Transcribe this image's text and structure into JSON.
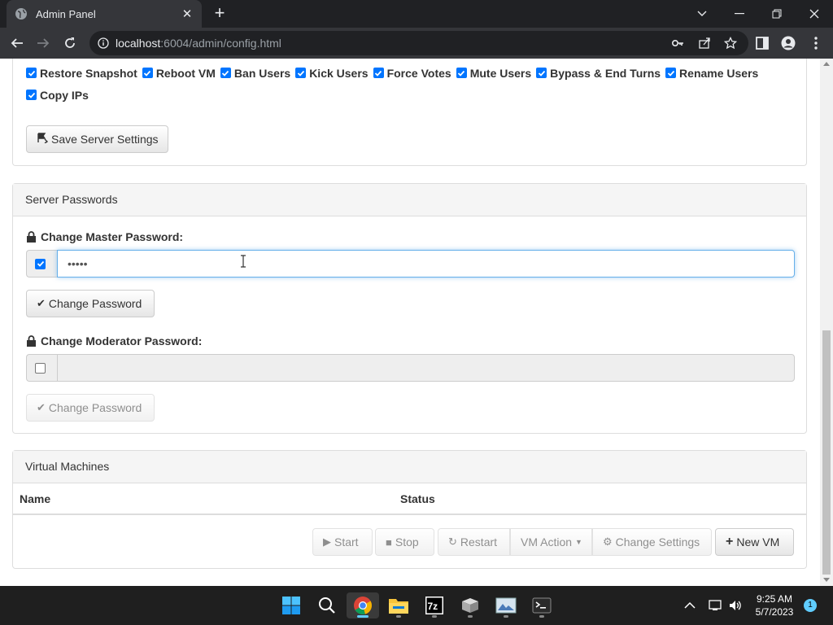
{
  "browser": {
    "tab_title": "Admin Panel",
    "url_host": "localhost",
    "url_rest": ":6004/admin/config.html"
  },
  "permissions": [
    {
      "label": "Restore Snapshot",
      "checked": true
    },
    {
      "label": "Reboot VM",
      "checked": true
    },
    {
      "label": "Ban Users",
      "checked": true
    },
    {
      "label": "Kick Users",
      "checked": true
    },
    {
      "label": "Force Votes",
      "checked": true
    },
    {
      "label": "Mute Users",
      "checked": true
    },
    {
      "label": "Bypass & End Turns",
      "checked": true
    },
    {
      "label": "Rename Users",
      "checked": true
    },
    {
      "label": "Copy IPs",
      "checked": true
    }
  ],
  "server_settings": {
    "save_label": "Save Server Settings"
  },
  "passwords": {
    "heading": "Server Passwords",
    "master_label": "Change Master Password:",
    "master_value": "•••••",
    "master_enabled": true,
    "master_button": "Change Password",
    "moderator_label": "Change Moderator Password:",
    "moderator_value": "",
    "moderator_enabled": false,
    "moderator_button": "Change Password"
  },
  "vms": {
    "heading": "Virtual Machines",
    "col_name": "Name",
    "col_status": "Status",
    "start_label": "Start",
    "stop_label": "Stop",
    "restart_label": "Restart",
    "action_label": "VM Action",
    "settings_label": "Change Settings",
    "new_label": "New VM"
  },
  "taskbar": {
    "time": "9:25 AM",
    "date": "5/7/2023",
    "notifications": "1",
    "apps": [
      "start-icon",
      "search-icon",
      "chrome-icon",
      "file-explorer-icon",
      "7zip-icon",
      "package-icon",
      "photo-icon",
      "terminal-icon"
    ]
  },
  "colors": {
    "checkbox": "#0075ff",
    "accent": "#60cdff"
  }
}
